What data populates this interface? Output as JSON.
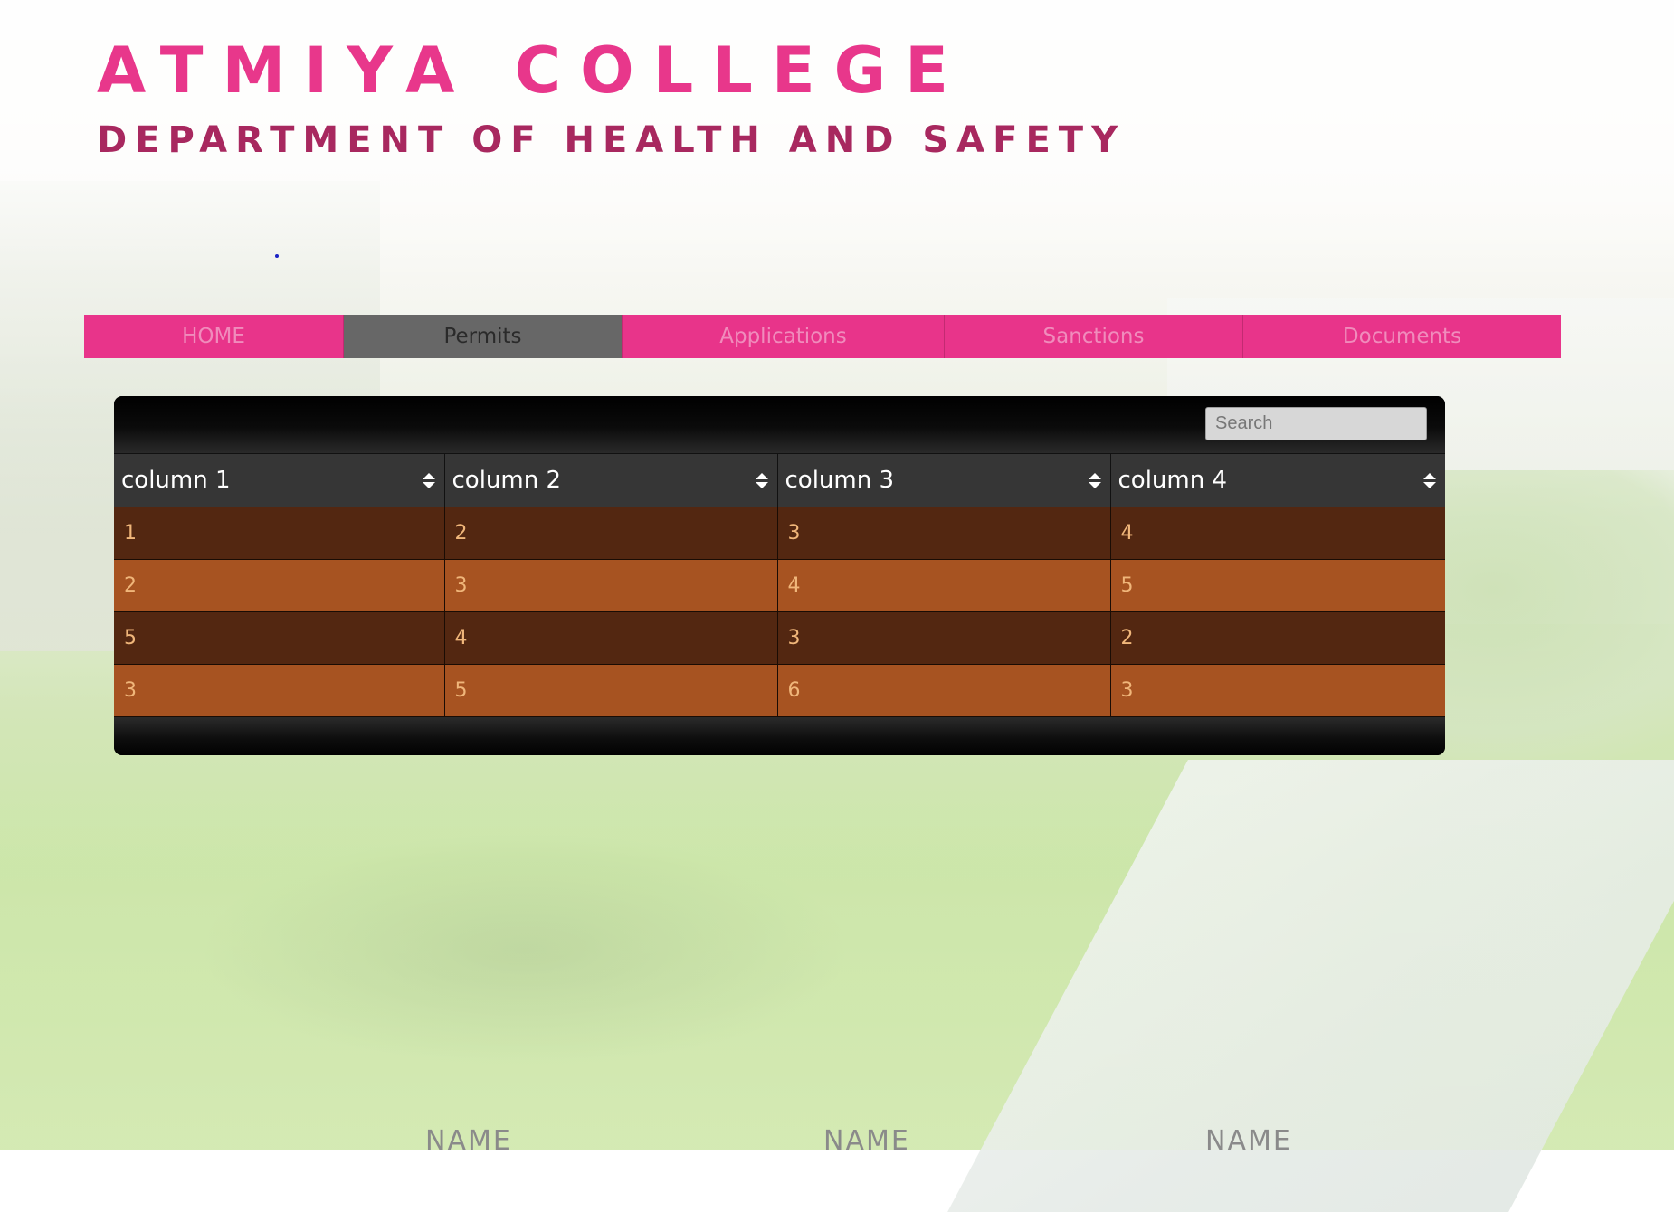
{
  "header": {
    "title": "ATMIYA COLLEGE",
    "subtitle": "DEPARTMENT OF HEALTH AND SAFETY"
  },
  "nav": {
    "items": [
      {
        "label": "HOME",
        "active": false
      },
      {
        "label": "Permits",
        "active": true
      },
      {
        "label": "Applications",
        "active": false
      },
      {
        "label": "Sanctions",
        "active": false
      },
      {
        "label": "Documents",
        "active": false
      }
    ]
  },
  "table": {
    "search_placeholder": "Search",
    "search_value": "",
    "columns": [
      "column 1",
      "column 2",
      "column 3",
      "column 4"
    ],
    "rows": [
      [
        "1",
        "2",
        "3",
        "4"
      ],
      [
        "2",
        "3",
        "4",
        "5"
      ],
      [
        "5",
        "4",
        "3",
        "2"
      ],
      [
        "3",
        "5",
        "6",
        "3"
      ]
    ],
    "sort_icon": "sort-both-icon"
  },
  "footer": {
    "names": [
      "NAME",
      "NAME",
      "NAME"
    ]
  },
  "colors": {
    "accent_pink": "#e8378b",
    "subtitle_magenta": "#a8285f",
    "nav_active": "#676767",
    "row_dark": "#532711",
    "row_light": "#a75321",
    "cell_text": "#f0b67a"
  }
}
